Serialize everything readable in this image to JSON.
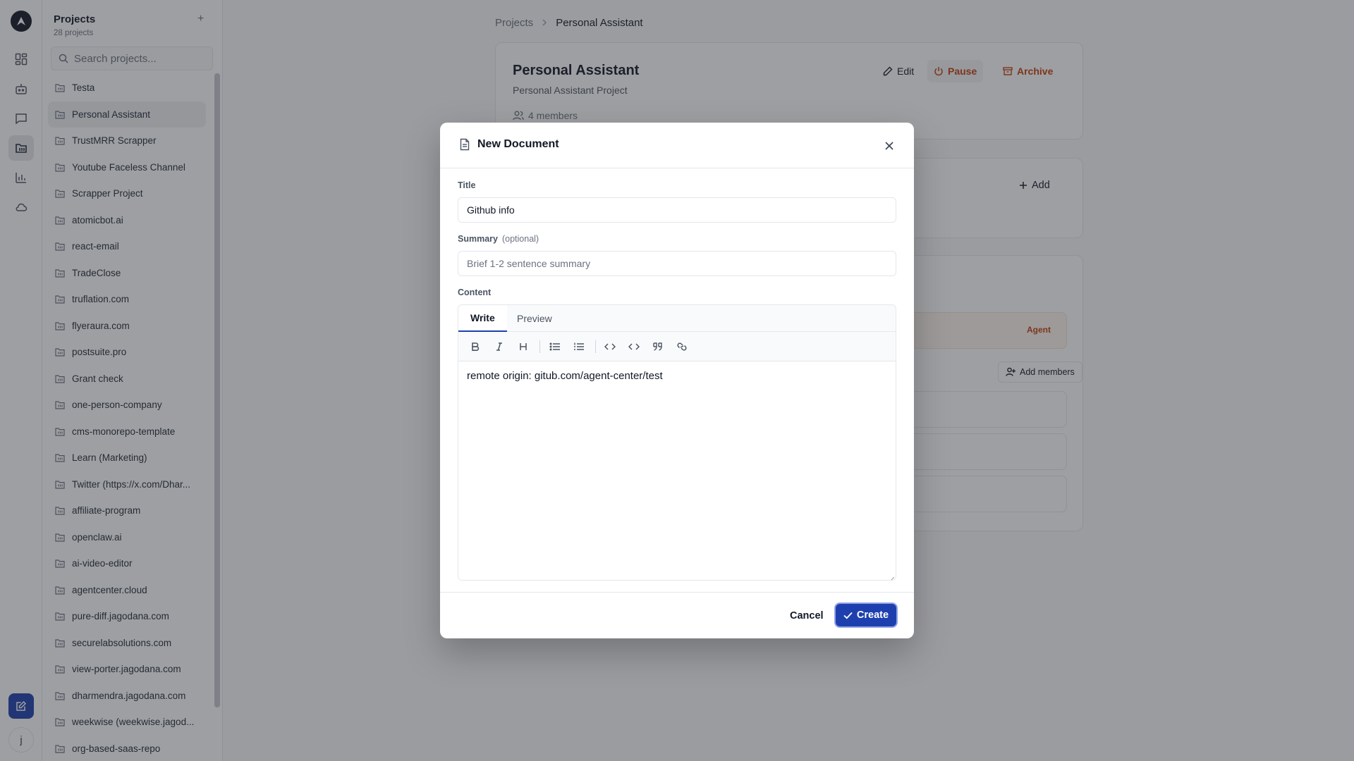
{
  "rail": {
    "user_initial": "j",
    "icons": [
      "dashboard-icon",
      "bot-icon",
      "chat-icon",
      "projects-icon",
      "analytics-icon",
      "cloud-icon"
    ],
    "compose_icon": "compose-icon"
  },
  "sidebar": {
    "title": "Projects",
    "count": "28 projects",
    "add_label": "+",
    "search_placeholder": "Search projects...",
    "items": [
      {
        "label": "Testa"
      },
      {
        "label": "Personal Assistant",
        "active": true
      },
      {
        "label": "TrustMRR Scrapper"
      },
      {
        "label": "Youtube Faceless Channel"
      },
      {
        "label": "Scrapper Project"
      },
      {
        "label": "atomicbot.ai"
      },
      {
        "label": "react-email"
      },
      {
        "label": "TradeClose"
      },
      {
        "label": "truflation.com"
      },
      {
        "label": "flyeraura.com"
      },
      {
        "label": "postsuite.pro"
      },
      {
        "label": "Grant check"
      },
      {
        "label": "one-person-company"
      },
      {
        "label": "cms-monorepo-template"
      },
      {
        "label": "Learn (Marketing)"
      },
      {
        "label": "Twitter (https://x.com/Dhar..."
      },
      {
        "label": "affiliate-program"
      },
      {
        "label": "openclaw.ai"
      },
      {
        "label": "ai-video-editor"
      },
      {
        "label": "agentcenter.cloud"
      },
      {
        "label": "pure-diff.jagodana.com"
      },
      {
        "label": "securelabsolutions.com"
      },
      {
        "label": "view-porter.jagodana.com"
      },
      {
        "label": "dharmendra.jagodana.com"
      },
      {
        "label": "weekwise (weekwise.jagod..."
      },
      {
        "label": "org-based-saas-repo"
      }
    ]
  },
  "breadcrumb": {
    "root": "Projects",
    "current": "Personal Assistant"
  },
  "project": {
    "title": "Personal Assistant",
    "description": "Personal Assistant Project",
    "members": "4 members",
    "edit_label": "Edit",
    "pause_label": "Pause",
    "archive_label": "Archive",
    "add_label": "Add",
    "agent_tag": "Agent",
    "add_members_label": "Add members"
  },
  "modal": {
    "title": "New Document",
    "title_label": "Title",
    "title_value": "Github info",
    "summary_label": "Summary",
    "summary_optional": "(optional)",
    "summary_placeholder": "Brief 1-2 sentence summary",
    "content_label": "Content",
    "tab_write": "Write",
    "tab_preview": "Preview",
    "toolbar": [
      "bold-icon",
      "italic-icon",
      "heading-icon",
      "bullet-list-icon",
      "numbered-list-icon",
      "inline-code-icon",
      "code-block-icon",
      "quote-icon",
      "link-icon"
    ],
    "content_value": "remote origin: gitub.com/agent-center/test",
    "cancel_label": "Cancel",
    "create_label": "Create"
  },
  "colors": {
    "primary": "#1e40af",
    "warning": "#c2410c",
    "overlay": "rgba(40,42,48,0.45)"
  }
}
